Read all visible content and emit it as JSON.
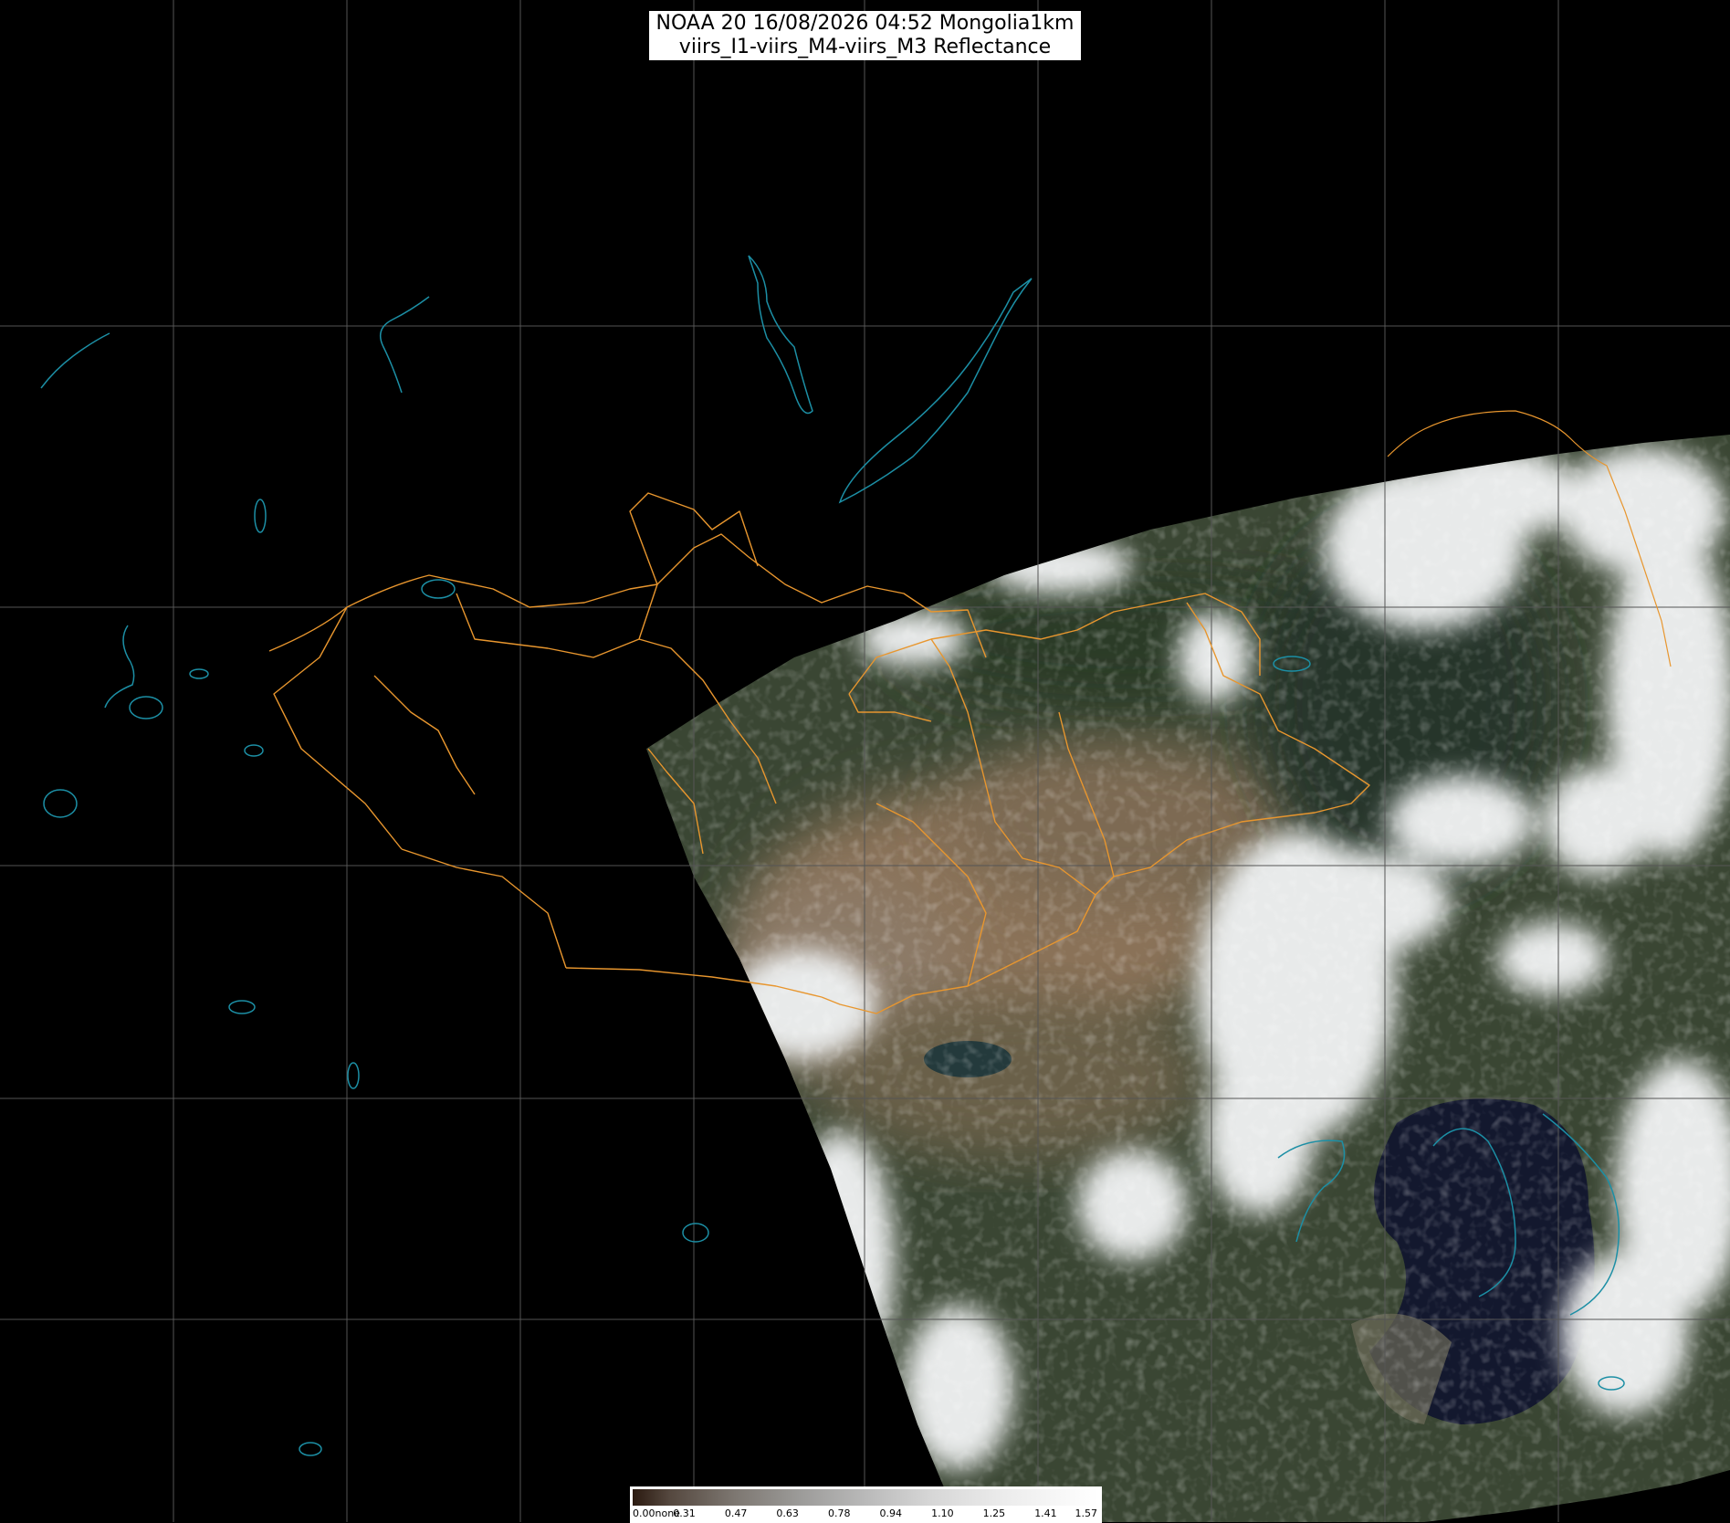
{
  "title": {
    "line1": "NOAA 20 16/08/2026 04:52 Mongolia1km",
    "line2": "viirs_I1-viirs_M4-viirs_M3 Reflectance"
  },
  "colorbar": {
    "ticks": [
      "0.00none",
      "0.31",
      "0.47",
      "0.63",
      "0.78",
      "0.94",
      "1.10",
      "1.25",
      "1.41",
      "1.57"
    ]
  },
  "colors": {
    "background": "#000000",
    "grid": "#555555",
    "coast": "#1c8fa5",
    "border": "#e8962e",
    "cloud": "#e8eaea",
    "land_desert": "#8a7258",
    "land_forest": "#34432d",
    "sea": "#13182e"
  }
}
